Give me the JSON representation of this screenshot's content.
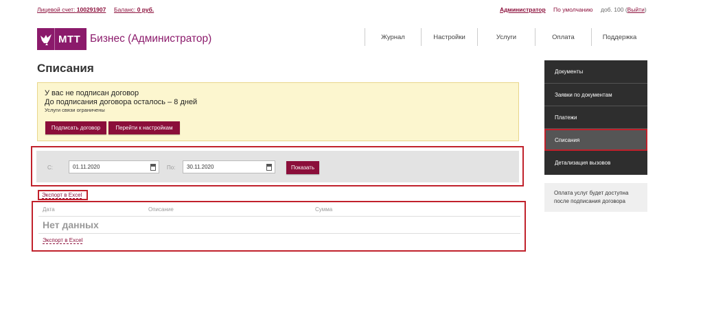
{
  "topbar": {
    "account_label": "Лицевой счет:",
    "account_number": "100291907",
    "balance_label": "Баланс:",
    "balance_value": "0 руб.",
    "user_name": "Администратор",
    "default_label": "По умолчанию",
    "ext_label": "доб. 100 (",
    "logout_label": "Выйти",
    "ext_close": ")"
  },
  "logo": {
    "brand": "МТТ",
    "title": "Бизнес (Администратор)"
  },
  "nav": {
    "items": [
      {
        "label": "Журнал"
      },
      {
        "label": "Настройки"
      },
      {
        "label": "Услуги"
      },
      {
        "label": "Оплата"
      },
      {
        "label": "Поддержка"
      }
    ]
  },
  "page": {
    "title": "Списания"
  },
  "notice": {
    "line1": "У вас не подписан договор",
    "line2": "До подписания договора осталось – 8 дней",
    "line3": "Услуги связи ограничены",
    "sign_button": "Подписать договор",
    "settings_button": "Перейти к настройкам"
  },
  "filter": {
    "from_label": "С:",
    "from_value": "01.11.2020",
    "to_label": "По:",
    "to_value": "30.11.2020",
    "show_button": "Показать"
  },
  "export_label": "Экспорт в Excel",
  "table": {
    "columns": [
      "Дата",
      "Описание",
      "Сумма"
    ],
    "empty_text": "Нет данных",
    "export_label": "Экспорт в Excel"
  },
  "sidebar": {
    "items": [
      {
        "label": "Документы"
      },
      {
        "label": "Заявки по документам"
      },
      {
        "label": "Платежи"
      },
      {
        "label": "Списания"
      },
      {
        "label": "Детализация вызовов"
      }
    ],
    "info": "Оплата услуг будет доступна после подписания договора"
  },
  "colors": {
    "brand": "#8b1a6b",
    "accent": "#8b0e3a",
    "highlight": "#c0202a",
    "notice_bg": "#fcf6cf",
    "sidebar_bg": "#2e2e2e"
  },
  "icons": {
    "logo": "bird-icon",
    "date": "calendar-icon"
  }
}
